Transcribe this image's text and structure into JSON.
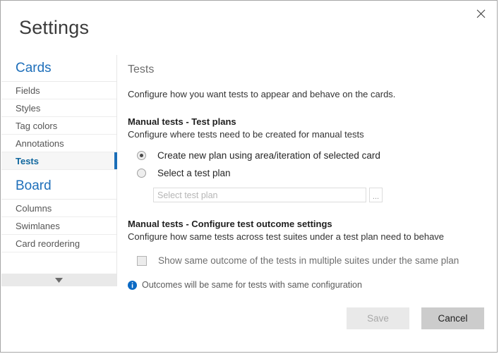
{
  "dialog": {
    "title": "Settings",
    "close_icon": "close-icon"
  },
  "sidebar": {
    "groups": [
      {
        "title": "Cards",
        "items": [
          {
            "label": "Fields",
            "selected": false
          },
          {
            "label": "Styles",
            "selected": false
          },
          {
            "label": "Tag colors",
            "selected": false
          },
          {
            "label": "Annotations",
            "selected": false
          },
          {
            "label": "Tests",
            "selected": true
          }
        ]
      },
      {
        "title": "Board",
        "items": [
          {
            "label": "Columns",
            "selected": false
          },
          {
            "label": "Swimlanes",
            "selected": false
          },
          {
            "label": "Card reordering",
            "selected": false
          }
        ]
      }
    ],
    "scroll_down_icon": "chevron-down-icon"
  },
  "main": {
    "title": "Tests",
    "description": "Configure how you want tests to appear and behave on the cards.",
    "section_plans": {
      "heading": "Manual tests - Test plans",
      "subheading": "Configure where tests need to be created for manual tests",
      "options": [
        {
          "label": "Create new plan using area/iteration of selected card",
          "selected": true
        },
        {
          "label": "Select a test plan",
          "selected": false
        }
      ],
      "plan_input_value": "",
      "plan_input_placeholder": "Select test plan",
      "browse_label": "..."
    },
    "section_outcome": {
      "heading": "Manual tests - Configure test outcome settings",
      "subheading": "Configure how same tests across test suites under a test plan need to behave",
      "checkbox_label": "Show same outcome of the tests in multiple suites under the same plan",
      "checkbox_checked": false,
      "info_icon": "info-icon",
      "info_text": "Outcomes will be same for tests with same configuration"
    }
  },
  "footer": {
    "save_label": "Save",
    "cancel_label": "Cancel"
  },
  "colors": {
    "accent_blue": "#1a6eb8",
    "link_blue": "#1e6fba",
    "info_blue": "#0a69c4",
    "border_gray": "#a6a6a6"
  }
}
